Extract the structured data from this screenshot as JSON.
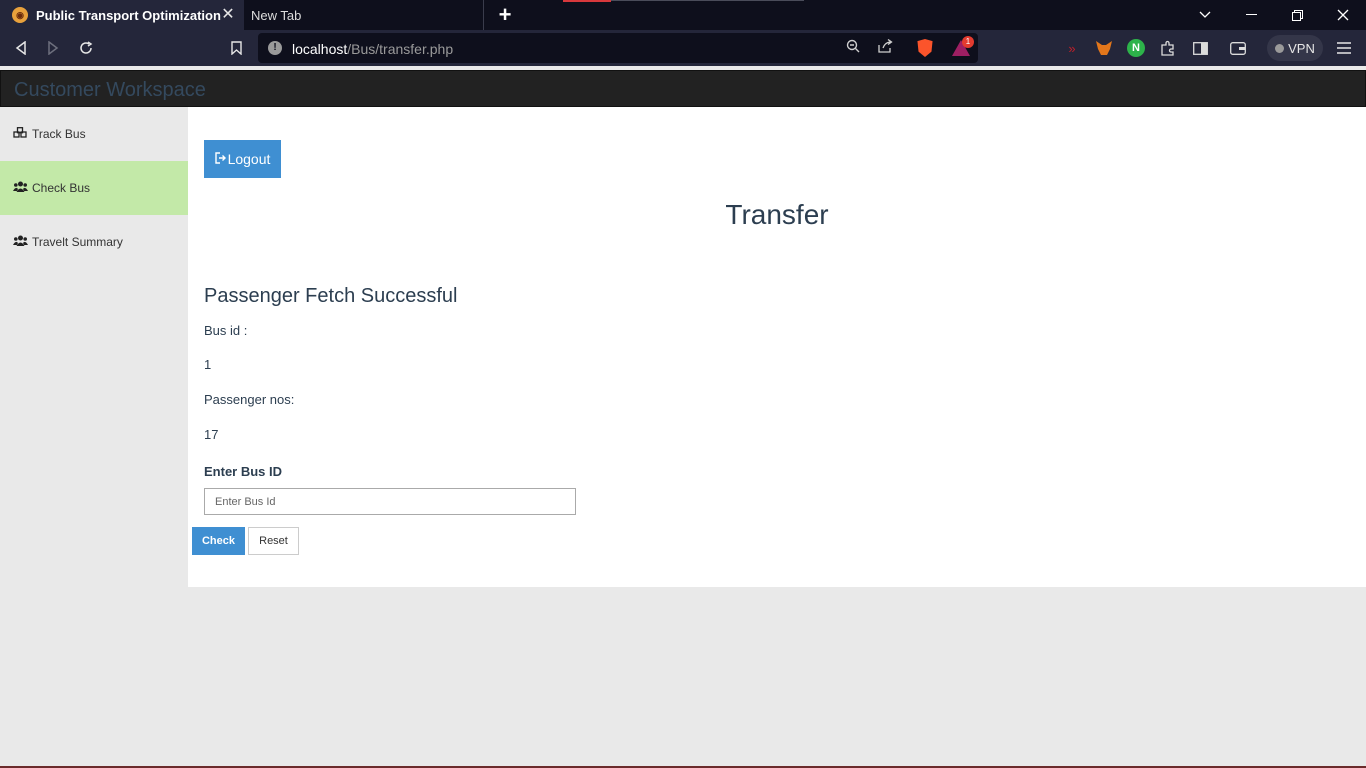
{
  "browser": {
    "active_tab_title": "Public Transport Optimization",
    "inactive_tab_title": "New Tab",
    "url_host": "localhost",
    "url_path": "/Bus/transfer.php",
    "rewards_badge": "1",
    "vpn_label": "VPN",
    "n_extension_letter": "N"
  },
  "app": {
    "brand": "Customer Workspace"
  },
  "sidebar": {
    "items": [
      {
        "label": "Track Bus",
        "icon": "cubes-icon",
        "active": false
      },
      {
        "label": "Check Bus",
        "icon": "users-icon",
        "active": true
      },
      {
        "label": "Travelt Summary",
        "icon": "users-icon",
        "active": false
      }
    ]
  },
  "main": {
    "logout_label": "Logout",
    "title": "Transfer",
    "result_heading": "Passenger Fetch Successful",
    "bus_id_label": "Bus id :",
    "bus_id_value": "1",
    "passenger_label": "Passenger nos:",
    "passenger_value": "17",
    "enter_label": "Enter Bus ID",
    "input_placeholder": "Enter Bus Id",
    "check_label": "Check",
    "reset_label": "Reset"
  }
}
